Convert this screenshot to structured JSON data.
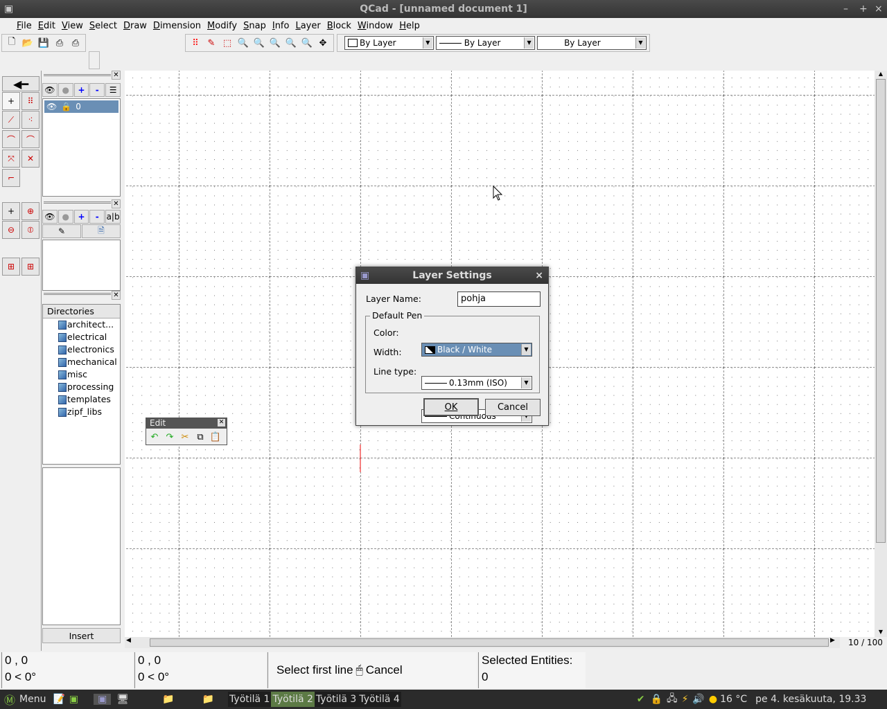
{
  "window": {
    "title": "QCad - [unnamed document 1]",
    "controls": [
      "–",
      "+",
      "×"
    ]
  },
  "menu": [
    "File",
    "Edit",
    "View",
    "Select",
    "Draw",
    "Dimension",
    "Modify",
    "Snap",
    "Info",
    "Layer",
    "Block",
    "Window",
    "Help"
  ],
  "toolbar": {
    "color": "By Layer",
    "width": "By Layer",
    "linetype": "By Layer"
  },
  "layers": {
    "items": [
      {
        "name": "0"
      }
    ]
  },
  "library": {
    "header": "Directories",
    "items": [
      "architect...",
      "electrical",
      "electronics",
      "mechanical",
      "misc",
      "processing",
      "templates",
      "zipf_libs"
    ],
    "insert": "Insert"
  },
  "edit_toolbar": {
    "title": "Edit"
  },
  "scroll": {
    "page": "10 / 100"
  },
  "dialog": {
    "title": "Layer Settings",
    "layer_name_label": "Layer Name:",
    "layer_name": "pohja",
    "group": "Default Pen",
    "color_label": "Color:",
    "color": "Black / White",
    "width_label": "Width:",
    "width": "0.13mm (ISO)",
    "linetype_label": "Line type:",
    "linetype": "Continuous",
    "ok": "OK",
    "cancel": "Cancel"
  },
  "status": {
    "abs_coord": "0 , 0",
    "abs_polar": "0 < 0°",
    "rel_coord": "0 , 0",
    "rel_polar": "0 < 0°",
    "left_action": "Select first line",
    "right_action": "Cancel",
    "selected_label": "Selected Entities:",
    "selected_count": "0"
  },
  "taskbar": {
    "menu": "Menu",
    "workspaces": [
      "Työtilä 1",
      "Työtilä 2",
      "Työtilä 3",
      "Työtilä 4"
    ],
    "active_workspace": 1,
    "weather": "16 °C",
    "clock": "pe  4. kesäkuuta, 19.33"
  },
  "colors": {
    "selection": "#6a8fb5",
    "taskbar": "#2b2b2b",
    "active_workspace": "#5c7a45"
  }
}
